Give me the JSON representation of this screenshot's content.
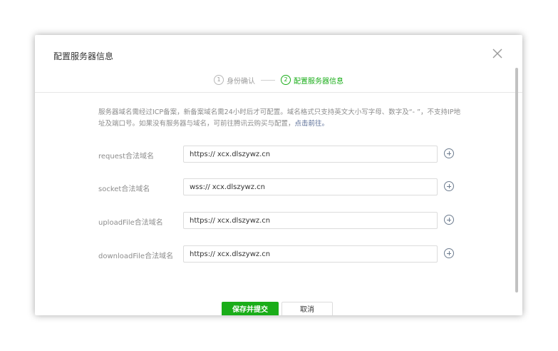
{
  "dialog": {
    "title": "配置服务器信息",
    "close_icon": "close-icon"
  },
  "steps": [
    {
      "num": "1",
      "label": "身份确认",
      "active": false
    },
    {
      "num": "2",
      "label": "配置服务器信息",
      "active": true
    }
  ],
  "notice": {
    "text": "服务器域名需经过ICP备案，新备案域名需24小时后才可配置。域名格式只支持英文大小写字母、数字及“- ”，不支持IP地址及端口号。如果没有服务器与域名，可前往腾讯云购买与配置，",
    "link": "点击前往。"
  },
  "rows": [
    {
      "label": "request合法域名",
      "prefix": "https://",
      "value": "xcx.dlszywz.cn"
    },
    {
      "label": "socket合法域名",
      "prefix": "wss://",
      "value": "xcx.dlszywz.cn"
    },
    {
      "label": "uploadFile合法域名",
      "prefix": "https://",
      "value": "xcx.dlszywz.cn"
    },
    {
      "label": "downloadFile合法域名",
      "prefix": "https://",
      "value": "xcx.dlszywz.cn"
    }
  ],
  "footer": {
    "save_label": "保存并提交",
    "cancel_label": "取消"
  },
  "colors": {
    "accent": "#1aad19",
    "link": "#576b95"
  }
}
